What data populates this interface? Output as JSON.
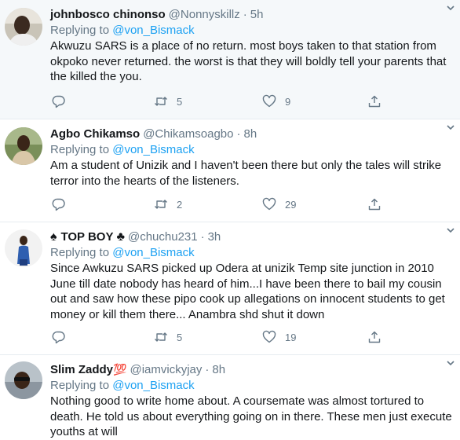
{
  "tweets": [
    {
      "name": "johnbosco chinonso",
      "handle": "@Nonnyskillz",
      "time": "5h",
      "replying_prefix": "Replying to",
      "replying_to": "@von_Bismack",
      "text": "Akwuzu SARS is a place of no return. most boys taken to that station from okpoko never returned. the worst is that they will boldly tell your parents that the killed the you.",
      "retweets": "5",
      "likes": "9",
      "replies": ""
    },
    {
      "name": "Agbo Chikamso",
      "handle": "@Chikamsoagbo",
      "time": "8h",
      "replying_prefix": "Replying to",
      "replying_to": "@von_Bismack",
      "text": "Am a student of Unizik and I haven't been there but only the tales will strike terror into the hearts of the listeners.",
      "retweets": "2",
      "likes": "29",
      "replies": ""
    },
    {
      "name_prefix": "♠",
      "name": "TOP BOY",
      "name_suffix": "♣",
      "handle": "@chuchu231",
      "time": "3h",
      "replying_prefix": "Replying to",
      "replying_to": "@von_Bismack",
      "text": "Since Awkuzu SARS picked up Odera at unizik Temp site junction in 2010 June till date nobody has heard of him...I have been there to bail my cousin out and saw how these pipo cook up allegations on innocent students to get money or kill them there... Anambra shd shut it down",
      "retweets": "5",
      "likes": "19",
      "replies": ""
    },
    {
      "name": "Slim Zaddy",
      "name_emoji": "💯",
      "handle": "@iamvickyjay",
      "time": "8h",
      "replying_prefix": "Replying to",
      "replying_to": "@von_Bismack",
      "text": "Nothing good to write home about.  A coursemate was almost tortured to death. He told us about everything going on in there. These men just execute youths at will"
    }
  ],
  "separator": "·",
  "icons": {
    "reply": "reply-icon",
    "retweet": "retweet-icon",
    "like": "heart-icon",
    "share": "share-icon",
    "caret": "chevron-down-icon"
  },
  "colors": {
    "accent": "#1da1f2",
    "secondary_text": "#657786",
    "highlight_bg": "#f5f8fa",
    "divider": "#e6ecf0"
  }
}
